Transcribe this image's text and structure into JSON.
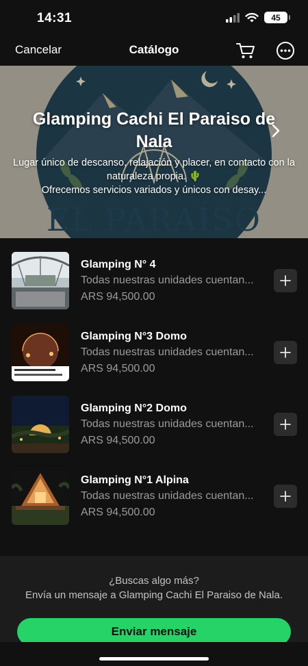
{
  "status_bar": {
    "time": "14:31",
    "battery": "45"
  },
  "nav": {
    "cancel_label": "Cancelar",
    "title": "Catálogo",
    "icons": [
      "cart-icon",
      "more-icon"
    ]
  },
  "hero": {
    "title": "Glamping Cachi El Paraiso de Nala",
    "description_line1": "Lugar único de descanso, relajación y placer, en contacto con la naturaleza propia. 🌵",
    "description_line2": "Ofrecemos servicios variados y únicos con desay...",
    "brand_text": "EL PARAÍSO"
  },
  "items": [
    {
      "name": "Glamping N° 4",
      "description": "Todas nuestras unidades cuentan...",
      "price": "ARS 94,500.00"
    },
    {
      "name": "Glamping N°3 Domo",
      "description": "Todas nuestras unidades cuentan...",
      "price": "ARS 94,500.00"
    },
    {
      "name": "Glamping N°2 Domo",
      "description": "Todas nuestras unidades cuentan...",
      "price": "ARS 94,500.00"
    },
    {
      "name": "Glamping N°1 Alpina",
      "description": "Todas nuestras unidades cuentan...",
      "price": "ARS 94,500.00"
    }
  ],
  "footer": {
    "question": "¿Buscas algo más?",
    "message": "Envía un mensaje a Glamping Cachi El Paraiso de Nala.",
    "button_label": "Enviar mensaje"
  },
  "colors": {
    "accent": "#25d366",
    "background": "#111111",
    "footer_bg": "#1c1c1d",
    "muted_text": "#9b9b9b"
  }
}
